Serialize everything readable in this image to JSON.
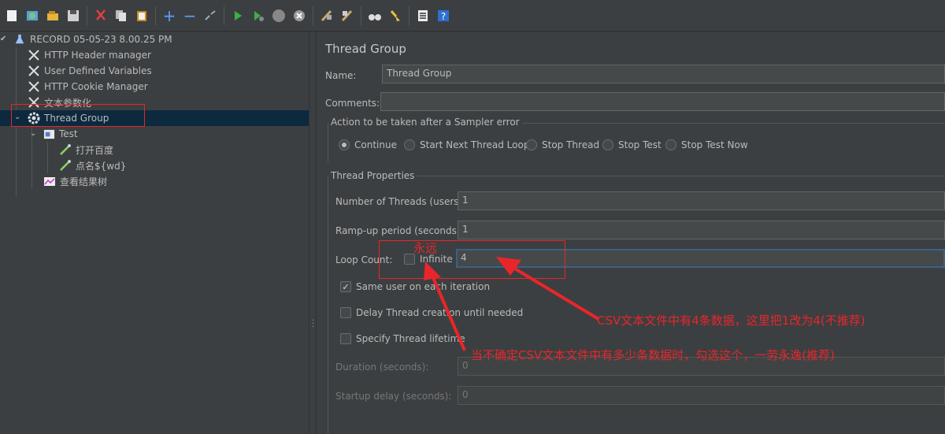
{
  "tree": {
    "items": [
      {
        "label": "RECORD 05-05-23 8.00.25 PM",
        "icon": "flask-icon"
      },
      {
        "label": "HTTP Header manager",
        "icon": "wrench-icon"
      },
      {
        "label": "User Defined Variables",
        "icon": "wrench-icon"
      },
      {
        "label": "HTTP Cookie Manager",
        "icon": "wrench-icon"
      },
      {
        "label": "文本参数化",
        "icon": "wrench-icon"
      },
      {
        "label": "Thread Group",
        "icon": "gear-icon"
      },
      {
        "label": "Test",
        "icon": "controller-icon"
      },
      {
        "label": "打开百度",
        "icon": "pipette-icon"
      },
      {
        "label": "点名${wd}",
        "icon": "pipette-icon"
      },
      {
        "label": "查看结果树",
        "icon": "chart-icon"
      }
    ]
  },
  "panel": {
    "title": "Thread Group",
    "name_label": "Name:",
    "name_value": "Thread Group",
    "comments_label": "Comments:",
    "comments_value": "",
    "error_action": {
      "title": "Action to be taken after a Sampler error",
      "options": [
        "Continue",
        "Start Next Thread Loop",
        "Stop Thread",
        "Stop Test",
        "Stop Test Now"
      ],
      "selected": "Continue"
    },
    "props": {
      "title": "Thread Properties",
      "threads_label": "Number of Threads (users):",
      "threads_value": "1",
      "rampup_label": "Ramp-up period (seconds):",
      "rampup_value": "1",
      "loop_label": "Loop Count:",
      "infinite_label": "Infinite",
      "infinite_checked": false,
      "loop_value": "4",
      "same_user_label": "Same user on each iteration",
      "same_user_checked": true,
      "delay_label": "Delay Thread creation until needed",
      "delay_checked": false,
      "lifetime_label": "Specify Thread lifetime",
      "lifetime_checked": false,
      "duration_label": "Duration (seconds):",
      "duration_value": "0",
      "startup_label": "Startup delay (seconds):",
      "startup_value": "0"
    }
  },
  "annotations": {
    "forever": "永远",
    "note_csv": "CSV文本文件中有4条数据，这里把1改为4(不推荐)",
    "note_unsure": "当不确定CSV文本文件中有多少条数据时，勾选这个，一劳永逸(推荐)",
    "color": "#e8262a"
  }
}
